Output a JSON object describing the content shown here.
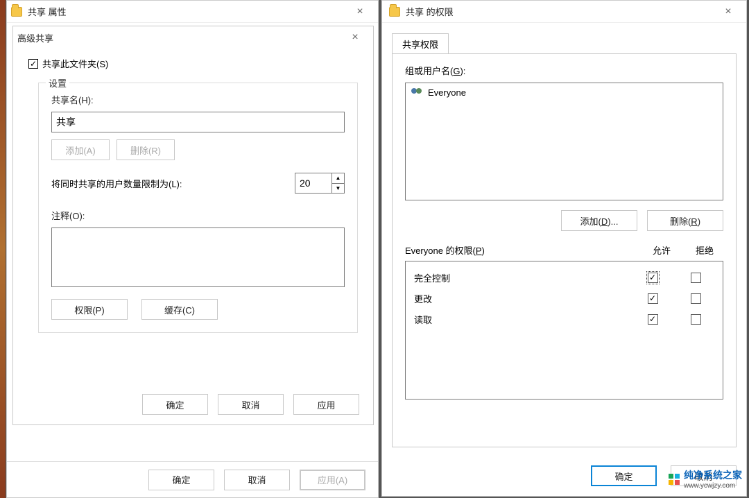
{
  "props_dialog": {
    "title": "共享 属性",
    "footer": {
      "ok": "确定",
      "cancel": "取消",
      "apply": "应用(A)"
    }
  },
  "adv_dialog": {
    "title": "高级共享",
    "share_this_folder": "共享此文件夹(S)",
    "settings_legend": "设置",
    "share_name_label": "共享名(H):",
    "share_name_value": "共享",
    "add_btn": "添加(A)",
    "remove_btn": "删除(R)",
    "limit_label": "将同时共享的用户数量限制为(L):",
    "limit_value": "20",
    "comment_label": "注释(O):",
    "comment_value": "",
    "perm_btn": "权限(P)",
    "cache_btn": "缓存(C)",
    "ok": "确定",
    "cancel": "取消",
    "apply": "应用"
  },
  "perm_dialog": {
    "title": "共享 的权限",
    "tab": "共享权限",
    "group_label_pre": "组或用户名(",
    "group_label_u": "G",
    "group_label_post": "):",
    "users": [
      "Everyone"
    ],
    "add_btn_pre": "添加(",
    "add_btn_u": "D",
    "add_btn_post": ")...",
    "remove_btn_pre": "删除(",
    "remove_btn_u": "R",
    "remove_btn_post": ")",
    "perm_for_pre": "Everyone 的权限(",
    "perm_for_u": "P",
    "perm_for_post": ")",
    "col_allow": "允许",
    "col_deny": "拒绝",
    "rows": [
      {
        "name": "完全控制",
        "allow": true,
        "deny": false
      },
      {
        "name": "更改",
        "allow": true,
        "deny": false
      },
      {
        "name": "读取",
        "allow": true,
        "deny": false
      }
    ],
    "ok": "确定",
    "cancel": "取消"
  },
  "watermark": {
    "brand": "纯净系统之家",
    "url": "www.ycwjzy.com"
  }
}
